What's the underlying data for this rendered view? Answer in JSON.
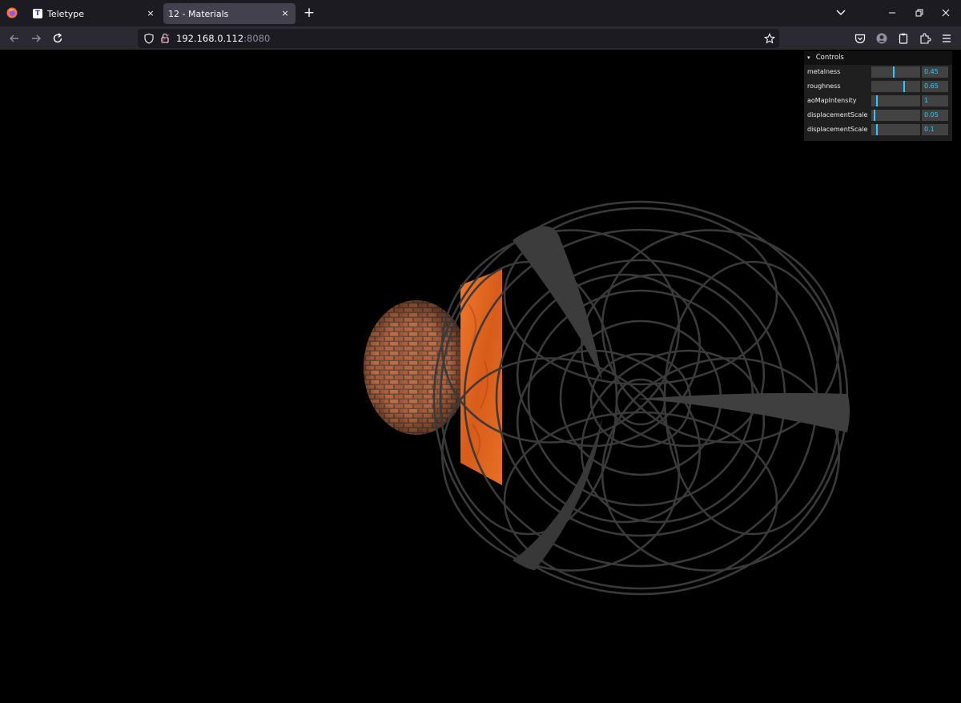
{
  "browser": {
    "tabs": [
      {
        "title": "Teletype",
        "favicon_letter": "T",
        "active": false
      },
      {
        "title": "12 - Materials",
        "active": true
      }
    ],
    "close_glyph": "×",
    "newtab_glyph": "+",
    "url": {
      "host": "192.168.0.112",
      "port": ":8080"
    }
  },
  "gui": {
    "title": "Controls",
    "controls": [
      {
        "label": "metalness",
        "value": "0.45",
        "fraction": 0.45
      },
      {
        "label": "roughness",
        "value": "0.65",
        "fraction": 0.65
      },
      {
        "label": "aoMapIntensity",
        "value": "1",
        "fraction": 0.1
      },
      {
        "label": "displacementScale",
        "value": "0.05",
        "fraction": 0.05
      },
      {
        "label": "displacementScale",
        "value": "0.1",
        "fraction": 0.1
      }
    ]
  },
  "colors": {
    "accent": "#2cc9ff",
    "brick": "#b0603a",
    "door": "#e0641f",
    "wire": "#3a3a3a"
  }
}
